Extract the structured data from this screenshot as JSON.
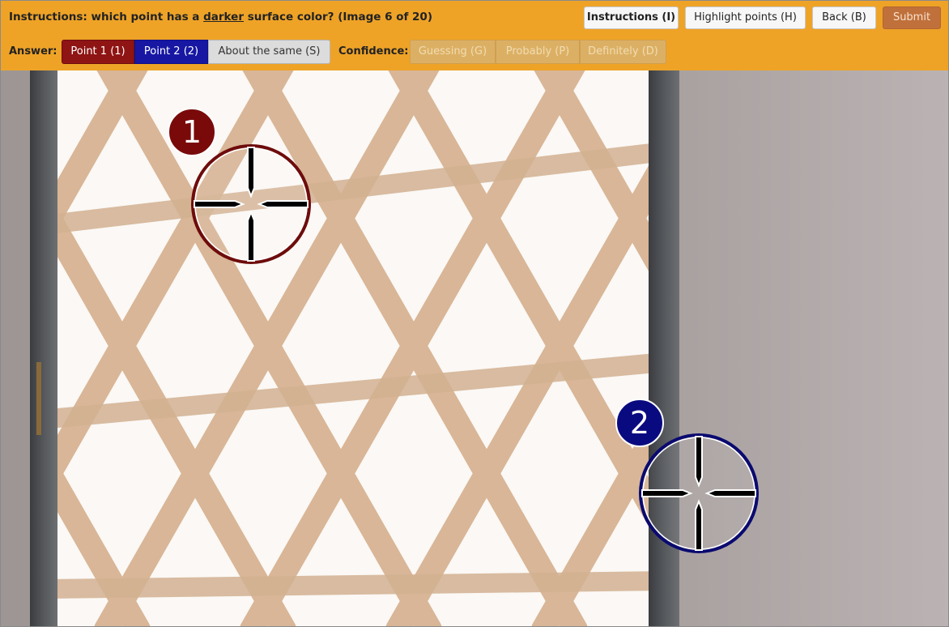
{
  "toolbar": {
    "instruction_prefix": "Instructions: which point has a ",
    "instruction_emphasis": "darker",
    "instruction_suffix": " surface color? (Image 6 of 20)",
    "instructions_button": "Instructions (I)",
    "highlight_button": "Highlight points (H)",
    "back_button": "Back (B)",
    "submit_button": "Submit"
  },
  "answer": {
    "label": "Answer:",
    "point1": "Point 1 (1)",
    "point2": "Point 2 (2)",
    "same": "About the same (S)"
  },
  "confidence": {
    "label": "Confidence:",
    "guessing": "Guessing (G)",
    "probably": "Probably (P)",
    "definitely": "Definitely (D)"
  },
  "points": [
    {
      "label": "1",
      "color": "#7a0a0a"
    },
    {
      "label": "2",
      "color": "#0a0a80"
    }
  ],
  "colors": {
    "toolbar_bg": "#eea327",
    "point1": "#8f1414",
    "point2": "#1717a3",
    "submit": "#c0703a"
  }
}
